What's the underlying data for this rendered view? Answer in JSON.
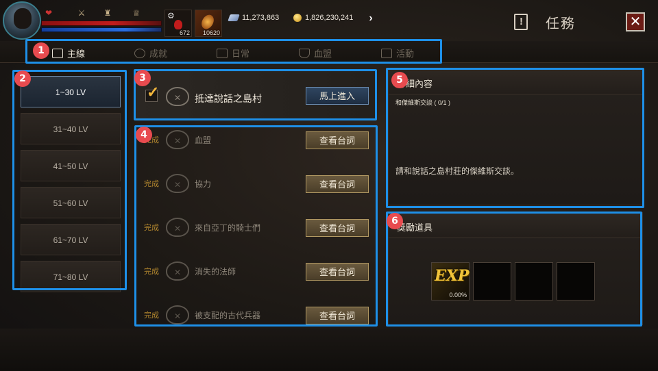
{
  "header": {
    "title": "任務",
    "close_label": "✕",
    "potion_count": "672",
    "item_count": "10620",
    "crystal_amount": "11,273,863",
    "gold_amount": "1,826,230,241",
    "next_glyph": "›"
  },
  "tabs": [
    {
      "label": "主線",
      "active": true
    },
    {
      "label": "成就",
      "active": false
    },
    {
      "label": "日常",
      "active": false
    },
    {
      "label": "血盟",
      "active": false
    },
    {
      "label": "活動",
      "active": false
    }
  ],
  "levels": [
    "1~30 LV",
    "31~40 LV",
    "41~50 LV",
    "51~60 LV",
    "61~70 LV",
    "71~80 LV"
  ],
  "main_quest": {
    "name": "抵達說話之島村",
    "button": "馬上進入"
  },
  "quests": [
    {
      "status": "完成",
      "name": "血盟",
      "button": "查看台詞"
    },
    {
      "status": "完成",
      "name": "協力",
      "button": "查看台詞"
    },
    {
      "status": "完成",
      "name": "來自亞丁的騎士們",
      "button": "查看台詞"
    },
    {
      "status": "完成",
      "name": "消失的法師",
      "button": "查看台詞"
    },
    {
      "status": "完成",
      "name": "被支配的古代兵器",
      "button": "查看台詞"
    }
  ],
  "detail": {
    "title": "詳細內容",
    "objective": "和傑維斯交談 ( 0/1 )",
    "description": "請和說話之島村莊的傑維斯交談。"
  },
  "reward": {
    "title": "獎勵道具",
    "exp_label": "EXP",
    "exp_percent": "0.00%"
  },
  "badges": [
    "1",
    "2",
    "3",
    "4",
    "5",
    "6"
  ],
  "colors": {
    "highlight": "#1e90e8",
    "badge": "#e84b4f",
    "done_text": "#b1862e",
    "accent_gold": "#f2b63b"
  }
}
